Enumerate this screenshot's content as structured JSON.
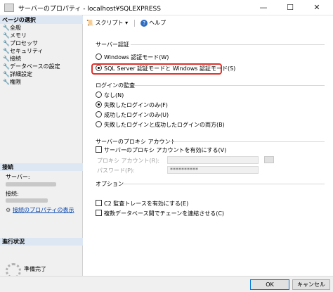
{
  "window": {
    "title": "サーバーのプロパティ - localhost¥SQLEXPRESS",
    "minimize": "—",
    "maximize": "☐",
    "close": "✕"
  },
  "sidebar": {
    "select_page_header": "ページの選択",
    "items": [
      {
        "label": "全般",
        "icon": "wrench-icon"
      },
      {
        "label": "メモリ",
        "icon": "wrench-icon"
      },
      {
        "label": "プロセッサ",
        "icon": "wrench-icon"
      },
      {
        "label": "セキュリティ",
        "icon": "wrench-icon"
      },
      {
        "label": "接続",
        "icon": "wrench-icon"
      },
      {
        "label": "データベースの設定",
        "icon": "wrench-icon"
      },
      {
        "label": "詳細設定",
        "icon": "wrench-icon"
      },
      {
        "label": "権限",
        "icon": "wrench-icon"
      }
    ],
    "connection_header": "接続",
    "server_label": "サーバー:",
    "connection_label": "接続:",
    "connection_properties_link": "接続のプロパティの表示",
    "progress_header": "進行状況",
    "progress_status": "準備完了"
  },
  "toolbar": {
    "script_label": "スクリプト",
    "help_label": "ヘルプ"
  },
  "server_auth": {
    "title": "サーバー認証",
    "windows_auth": "Windows 認証モード(W)",
    "mixed_auth": "SQL Server 認証モードと Windows 認証モード(S)",
    "selected": "mixed_auth"
  },
  "login_audit": {
    "title": "ログインの監査",
    "none": "なし(N)",
    "failed_only": "失敗したログインのみ(F)",
    "success_only": "成功したログインのみ(U)",
    "both": "失敗したログインと成功したログインの両方(B)",
    "selected": "failed_only"
  },
  "proxy": {
    "title": "サーバーのプロキシ アカウント",
    "enable_label": "サーバーのプロキシ アカウントを有効にする(V)",
    "enabled": false,
    "account_label": "プロキシ アカウント(R):",
    "account_value": "",
    "password_label": "パスワード(P):",
    "password_value": "**********"
  },
  "options": {
    "title": "オプション",
    "c2_audit": "C2 監査トレースを有効にする(E)",
    "cross_db_chaining": "複数データベース間でチェーンを連結させる(C)",
    "c2_checked": false,
    "chaining_checked": false
  },
  "footer": {
    "ok_label": "OK",
    "cancel_label": "キャンセル"
  },
  "colors": {
    "highlight_border": "#e0322b",
    "section_header_bg": "#dde7f3",
    "link": "#0645ad"
  }
}
